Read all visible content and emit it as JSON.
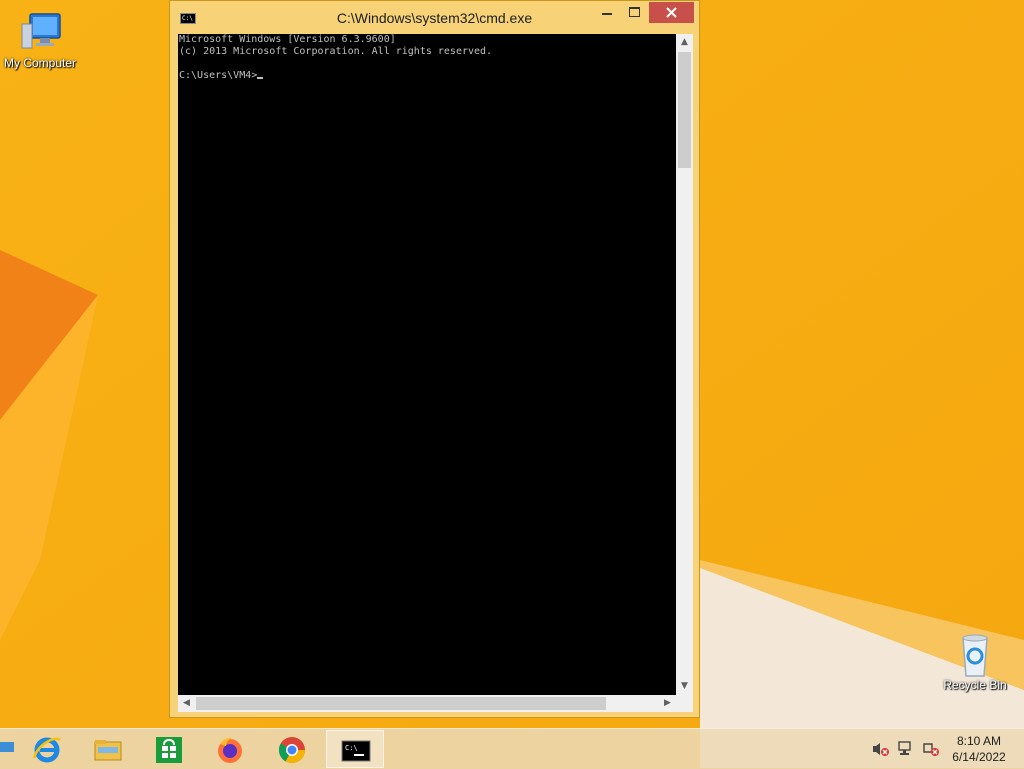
{
  "desktop": {
    "icons": [
      {
        "label": "My Computer",
        "icon": "computer-icon"
      },
      {
        "label": "Recycle Bin",
        "icon": "recycle-bin-icon"
      }
    ],
    "accent": "#f6ae12"
  },
  "window": {
    "title": "C:\\Windows\\system32\\cmd.exe",
    "console_lines": [
      "Microsoft Windows [Version 6.3.9600]",
      "(c) 2013 Microsoft Corporation. All rights reserved.",
      "",
      "C:\\Users\\VM4>"
    ],
    "buttons": {
      "minimize": "minimize-icon",
      "maximize": "maximize-icon",
      "close": "close-icon"
    }
  },
  "taskbar": {
    "pinned": [
      {
        "name": "internet-explorer",
        "icon": "ie-icon"
      },
      {
        "name": "file-explorer",
        "icon": "folder-icon"
      },
      {
        "name": "store",
        "icon": "store-icon"
      },
      {
        "name": "firefox",
        "icon": "firefox-icon"
      },
      {
        "name": "chrome",
        "icon": "chrome-icon"
      },
      {
        "name": "command-prompt",
        "icon": "cmd-icon",
        "active": true
      }
    ],
    "tray": {
      "icons": [
        "volume-muted-icon",
        "network-icon",
        "action-center-icon"
      ],
      "time": "8:10 AM",
      "date": "6/14/2022"
    }
  }
}
